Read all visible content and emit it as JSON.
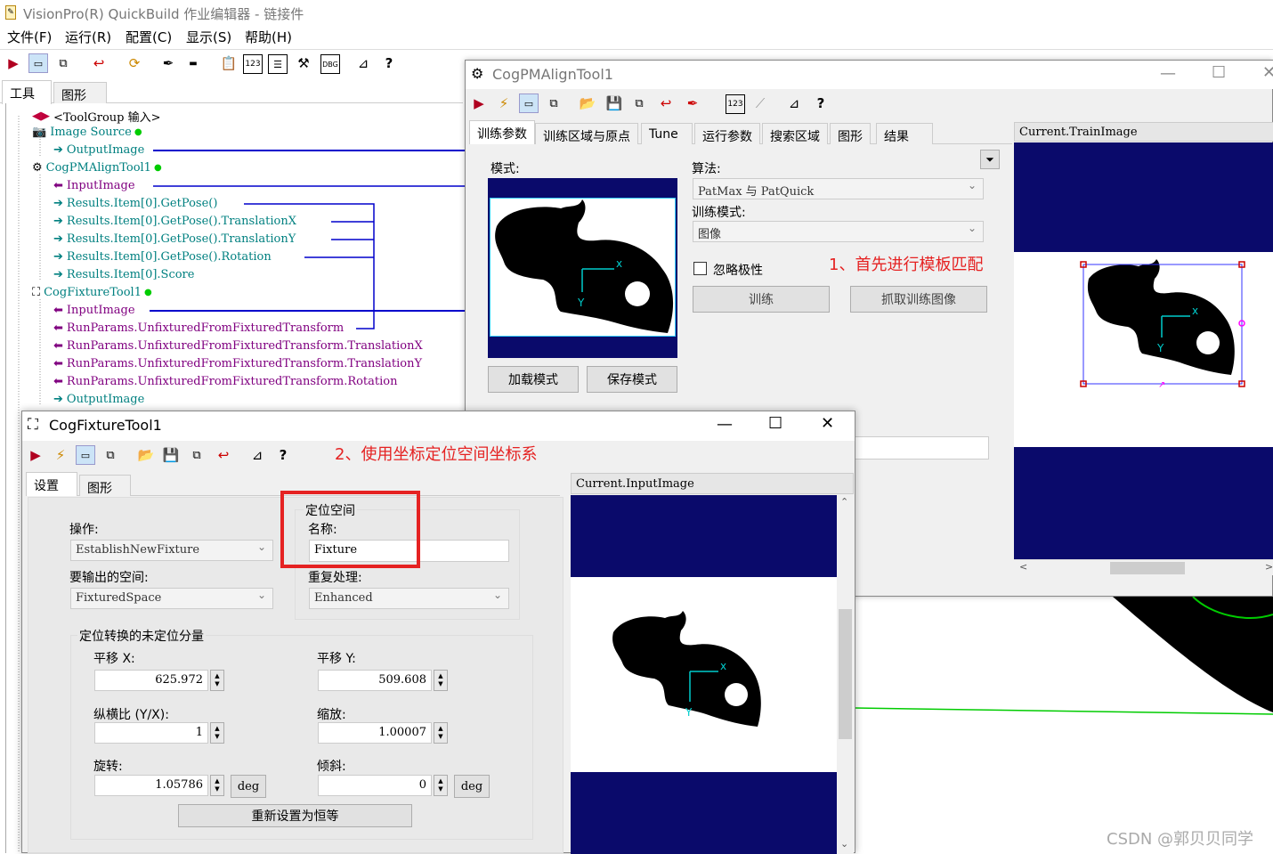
{
  "app": {
    "title": "VisionPro(R) QuickBuild 作业编辑器 - 链接件",
    "menu": [
      "文件(F)",
      "运行(R)",
      "配置(C)",
      "显示(S)",
      "帮助(H)"
    ],
    "tabs": [
      "工具",
      "图形"
    ]
  },
  "tree": {
    "items": [
      {
        "text": "<ToolGroup 输入>",
        "color": "#000000"
      },
      {
        "text": "Image Source",
        "color": "#008080"
      },
      {
        "text": "OutputImage",
        "color": "#008080"
      },
      {
        "text": "CogPMAlignTool1",
        "color": "#008080"
      },
      {
        "text": "InputImage",
        "color": "#800080"
      },
      {
        "text": "Results.Item[0].GetPose()",
        "color": "#008080"
      },
      {
        "text": "Results.Item[0].GetPose().TranslationX",
        "color": "#008080"
      },
      {
        "text": "Results.Item[0].GetPose().TranslationY",
        "color": "#008080"
      },
      {
        "text": "Results.Item[0].GetPose().Rotation",
        "color": "#008080"
      },
      {
        "text": "Results.Item[0].Score",
        "color": "#008080"
      },
      {
        "text": "CogFixtureTool1",
        "color": "#008080"
      },
      {
        "text": "InputImage",
        "color": "#800080"
      },
      {
        "text": "RunParams.UnfixturedFromFixturedTransform",
        "color": "#800080"
      },
      {
        "text": "RunParams.UnfixturedFromFixturedTransform.TranslationX",
        "color": "#800080"
      },
      {
        "text": "RunParams.UnfixturedFromFixturedTransform.TranslationY",
        "color": "#800080"
      },
      {
        "text": "RunParams.UnfixturedFromFixturedTransform.Rotation",
        "color": "#800080"
      },
      {
        "text": "OutputImage",
        "color": "#008080"
      }
    ]
  },
  "pm": {
    "title": "CogPMAlignTool1",
    "tabs": [
      "训练参数",
      "训练区域与原点",
      "Tune",
      "运行参数",
      "搜索区域",
      "图形",
      "结果"
    ],
    "pattern_label": "模式:",
    "algorithm_label": "算法:",
    "algorithm_value": "PatMax 与 PatQuick",
    "train_mode_label": "训练模式:",
    "train_mode_value": "图像",
    "ignore_polarity": "忽略极性",
    "train_button": "训练",
    "grab_button": "抓取训练图像",
    "load_button": "加载模式",
    "save_button": "保存模式",
    "image_caption": "Current.TrainImage",
    "note": "1、首先进行模板匹配",
    "expand_glyph": "⏷"
  },
  "fx": {
    "title": "CogFixtureTool1",
    "note": "2、使用坐标定位空间坐标系",
    "tabs": [
      "设置",
      "图形"
    ],
    "operation_label": "操作:",
    "operation_value": "EstablishNewFixture",
    "output_space_label": "要输出的空间:",
    "output_space_value": "FixturedSpace",
    "group_fixture": "定位空间",
    "name_label": "名称:",
    "name_value": "Fixture",
    "dup_label": "重复处理:",
    "dup_value": "Enhanced",
    "group_transform": "定位转换的未定位分量",
    "tx_label": "平移 X:",
    "tx_value": "625.972",
    "ty_label": "平移 Y:",
    "ty_value": "509.608",
    "aspect_label": "纵横比 (Y/X):",
    "aspect_value": "1",
    "scale_label": "缩放:",
    "scale_value": "1.00007",
    "rot_label": "旋转:",
    "rot_value": "1.05786",
    "skew_label": "倾斜:",
    "skew_value": "0",
    "deg": "deg",
    "reset_button": "重新设置为恒等",
    "image_caption": "Current.InputImage"
  },
  "watermark": "CSDN @郭贝贝同学",
  "colors": {
    "navy": "#0a0a6b",
    "red": "#e52222",
    "blue": "#0000cc"
  }
}
